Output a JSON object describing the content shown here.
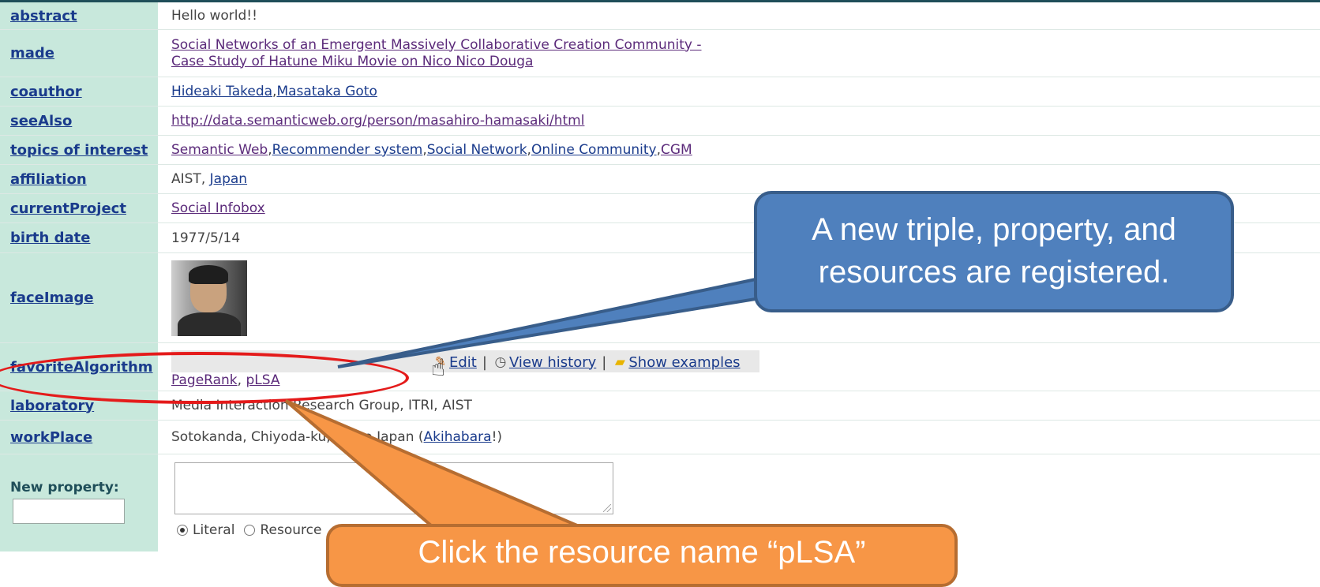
{
  "rows": {
    "abstract": {
      "key": "abstract",
      "value": "Hello world!!"
    },
    "made": {
      "key": "made",
      "line1": "Social Networks of an Emergent Massively Collaborative Creation Community -",
      "line2": "Case Study of Hatune Miku Movie on Nico Nico Douga"
    },
    "coauthor": {
      "key": "coauthor",
      "links": [
        "Hideaki Takeda",
        "Masataka Goto"
      ]
    },
    "seeAlso": {
      "key": "seeAlso",
      "url": "http://data.semanticweb.org/person/masahiro-hamasaki/html"
    },
    "topics": {
      "key": "topics of interest",
      "links": [
        "Semantic Web",
        "Recommender system",
        "Social Network",
        "Online Community",
        "CGM"
      ]
    },
    "affiliation": {
      "key": "affiliation",
      "text": "AIST, ",
      "link": "Japan"
    },
    "currentProject": {
      "key": "currentProject",
      "link": "Social Infobox"
    },
    "birthDate": {
      "key": "birth date",
      "value": "1977/5/14"
    },
    "faceImage": {
      "key": "faceImage"
    },
    "favoriteAlgorithm": {
      "key": "favoriteAlgorithm",
      "edit": "Edit",
      "history": "View history",
      "examples": "Show examples",
      "values": [
        "PageRank",
        "pLSA"
      ]
    },
    "laboratory": {
      "key": "laboratory",
      "value": "Media Interaction Research Group, ITRI, AIST"
    },
    "workPlace": {
      "key": "workPlace",
      "text": "Sotokanda, Chiyoda-ku, Tokyo Japan (",
      "link": "Akihabara",
      "tail": "!)"
    }
  },
  "newProperty": {
    "label": "New property:",
    "radio_literal": "Literal",
    "radio_resource": "Resource"
  },
  "callouts": {
    "blue": "A new triple, property, and resources are registered.",
    "orange": "Click the resource name “pLSA”"
  },
  "separators": {
    "comma": ", ",
    "pipe": "|"
  },
  "colors": {
    "key_bg": "#c8e8dc",
    "link": "#1a3b8c",
    "visited_link": "#5b2a7a",
    "callout_blue": "#4f80bd",
    "callout_orange": "#f79646",
    "highlight_ellipse": "#e41b1b"
  },
  "icons": [
    "edit-pencil-icon",
    "history-clock-icon",
    "examples-folder-icon",
    "hand-pointer-cursor-icon"
  ]
}
